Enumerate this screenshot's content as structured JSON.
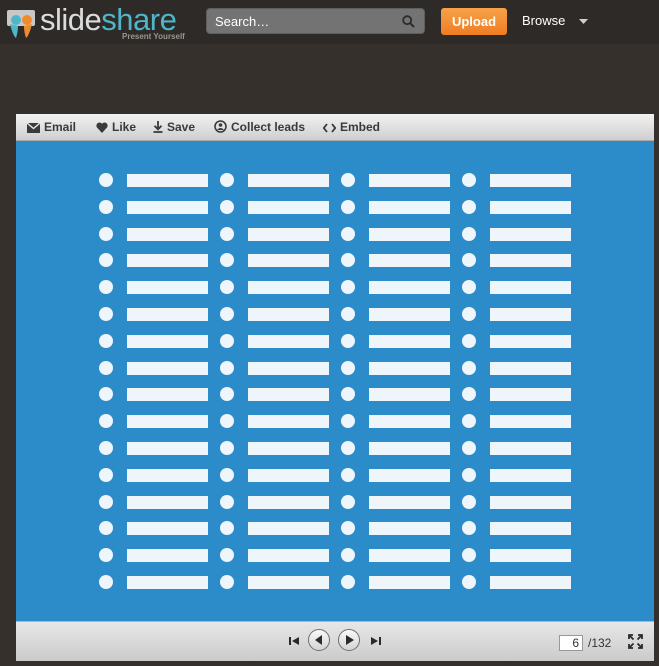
{
  "header": {
    "logo_part1": "slide",
    "logo_part2": "share",
    "tagline": "Present Yourself",
    "search_placeholder": "Search…",
    "upload_label": "Upload",
    "browse_label": "Browse"
  },
  "toolbar": {
    "email": "Email",
    "like": "Like",
    "save": "Save",
    "collect_leads": "Collect leads",
    "embed": "Embed"
  },
  "slide": {
    "columns": 4,
    "rows": 16,
    "background": "#2c8bc9"
  },
  "pager": {
    "current_page": "6",
    "total_pages": "/132"
  },
  "colors": {
    "upload": "#ef7d22",
    "logo_accent": "#4fb5c9",
    "slide_items": "#eef6fb"
  }
}
